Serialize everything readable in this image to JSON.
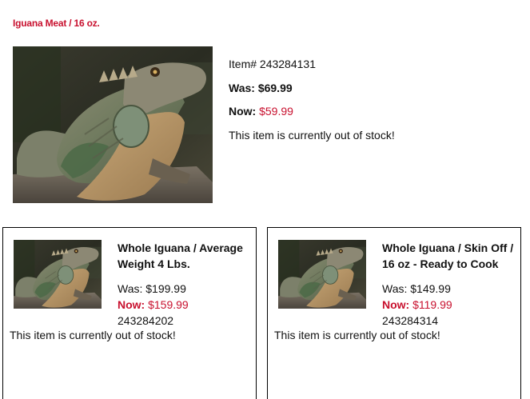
{
  "main": {
    "title": "Iguana Meat / 16 oz.",
    "item_number": "Item# 243284131",
    "was_label": "Was: $69.99",
    "now_label": "Now:",
    "now_price": "$59.99",
    "stock_status": "This item is currently out of stock!",
    "image_icon": "iguana-photo"
  },
  "related": [
    {
      "title": "Whole Iguana / Average Weight 4 Lbs.",
      "was": "Was: $199.99",
      "now_label": "Now:",
      "now_price": "$159.99",
      "item_number": "243284202",
      "stock_status": "This item is currently out of stock!",
      "image_icon": "iguana-photo"
    },
    {
      "title": "Whole Iguana / Skin Off / 16 oz - Ready to Cook",
      "was": "Was: $149.99",
      "now_label": "Now:",
      "now_price": "$119.99",
      "item_number": "243284314",
      "stock_status": "This item is currently out of stock!",
      "image_icon": "iguana-photo"
    }
  ],
  "colors": {
    "accent_red": "#c8102e",
    "text": "#111111",
    "border": "#000000"
  }
}
